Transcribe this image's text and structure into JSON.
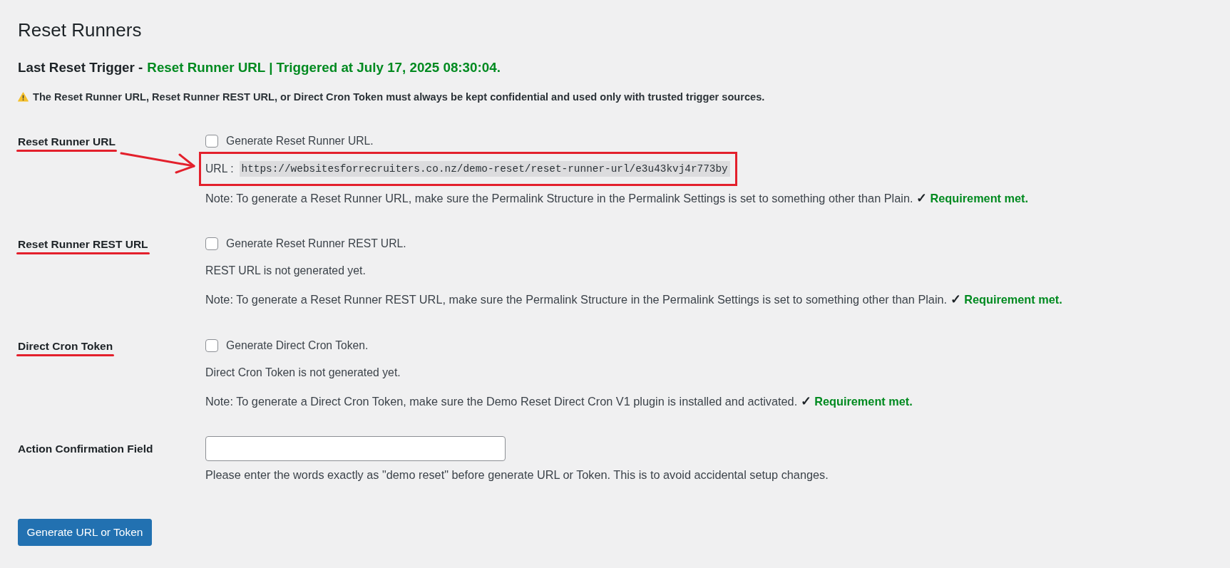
{
  "title": "Reset Runners",
  "last_trigger": {
    "label": "Last Reset Trigger -",
    "status": "Reset Runner URL | Triggered at July 17, 2025 08:30:04."
  },
  "warning": "The Reset Runner URL, Reset Runner REST URL, or Direct Cron Token must always be kept confidential and used only with trusted trigger sources.",
  "fields": [
    {
      "kind": "generator",
      "label": "Reset Runner URL",
      "underlined": true,
      "highlighted": true,
      "checkbox": {
        "label": "Generate Reset Runner URL.",
        "checked": false
      },
      "output": {
        "kind": "url",
        "label": "URL :",
        "value": "https://websitesforrecruiters.co.nz/demo-reset/reset-runner-url/e3u43kvj4r773by"
      },
      "note": "Note: To generate a Reset Runner URL, make sure the Permalink Structure in the Permalink Settings is set to something other than Plain.",
      "requirement": {
        "mark": "✓",
        "text": "Requirement met."
      }
    },
    {
      "kind": "generator",
      "label": "Reset Runner REST URL",
      "underlined": true,
      "highlighted": false,
      "checkbox": {
        "label": "Generate Reset Runner REST URL.",
        "checked": false
      },
      "output": {
        "kind": "status",
        "text": "REST URL is not generated yet."
      },
      "note": "Note: To generate a Reset Runner REST URL, make sure the Permalink Structure in the Permalink Settings is set to something other than Plain.",
      "requirement": {
        "mark": "✓",
        "text": "Requirement met."
      }
    },
    {
      "kind": "generator",
      "label": "Direct Cron Token",
      "underlined": true,
      "highlighted": false,
      "checkbox": {
        "label": "Generate Direct Cron Token.",
        "checked": false
      },
      "output": {
        "kind": "status",
        "text": "Direct Cron Token is not generated yet."
      },
      "note": "Note: To generate a Direct Cron Token, make sure the Demo Reset Direct Cron V1 plugin is installed and activated.",
      "requirement": {
        "mark": "✓",
        "text": "Requirement met."
      }
    },
    {
      "kind": "confirmation",
      "label": "Action Confirmation Field",
      "underlined": false,
      "help": "Please enter the words exactly as \"demo reset\" before generate URL or Token. This is to avoid accidental setup changes."
    }
  ],
  "button": "Generate URL or Token"
}
